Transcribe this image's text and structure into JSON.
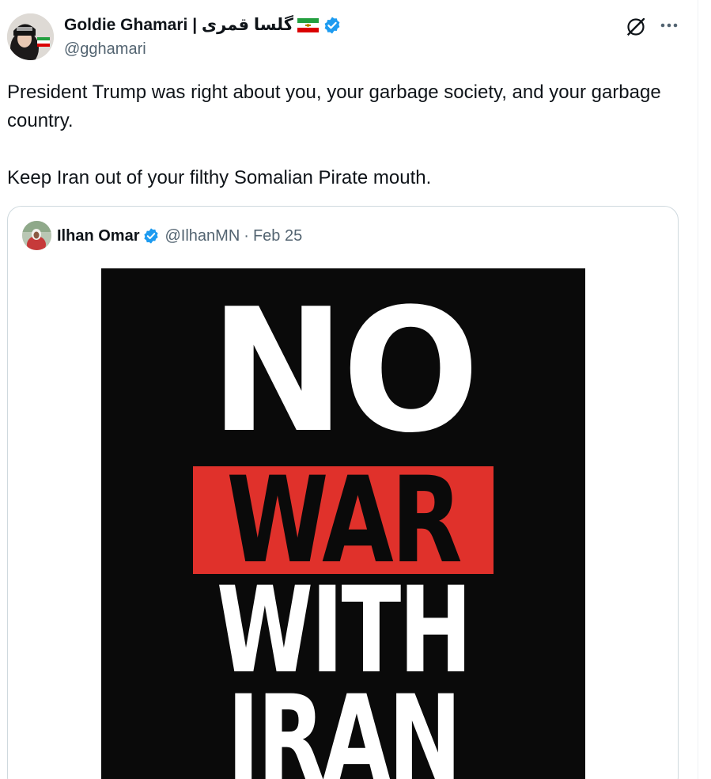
{
  "tweet": {
    "author_name": "Goldie Ghamari | گلسا قمری",
    "author_handle": "@gghamari",
    "text_lines": [
      "President Trump was right about you, your garbage society, and your garbage country.",
      "Keep Iran out of your filthy Somalian Pirate mouth."
    ],
    "icons": {
      "avatar": "profile-photo",
      "flag": "iran-lion-and-sun-flag-icon",
      "verified": "verified-badge-icon",
      "grok": "grok-icon",
      "more": "more-options-icon"
    }
  },
  "quoted_tweet": {
    "author_name": "Ilhan Omar",
    "author_handle": "@IlhanMN",
    "separator": "·",
    "date": "Feb 25",
    "poster": {
      "word_1": "NO",
      "word_2": "WAR",
      "word_3": "WITH",
      "word_4": "IRAN"
    }
  },
  "colors": {
    "verified_blue": "#1d9bf0",
    "secondary_text": "#536471",
    "border": "#cfd9de",
    "poster_background": "#0a0a0a",
    "poster_red": "#e0312b"
  }
}
